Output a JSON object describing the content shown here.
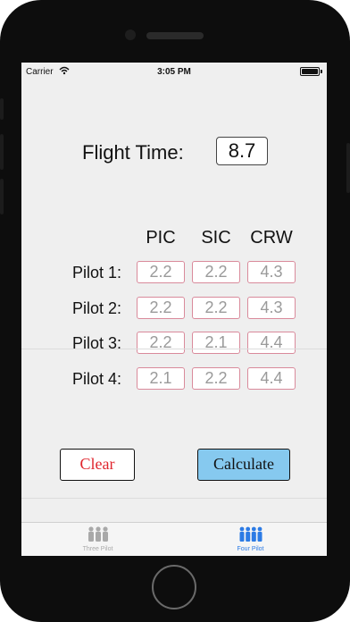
{
  "status": {
    "carrier": "Carrier",
    "time": "3:05 PM"
  },
  "flight_time": {
    "label": "Flight Time:",
    "value": "8.7"
  },
  "columns": [
    "PIC",
    "SIC",
    "CRW"
  ],
  "pilots": [
    {
      "label": "Pilot 1:",
      "values": [
        "2.2",
        "2.2",
        "4.3"
      ]
    },
    {
      "label": "Pilot 2:",
      "values": [
        "2.2",
        "2.2",
        "4.3"
      ]
    },
    {
      "label": "Pilot 3:",
      "values": [
        "2.2",
        "2.1",
        "4.4"
      ]
    },
    {
      "label": "Pilot 4:",
      "values": [
        "2.1",
        "2.2",
        "4.4"
      ]
    }
  ],
  "buttons": {
    "clear": "Clear",
    "calculate": "Calculate"
  },
  "tabs": [
    {
      "label": "Three Pilot",
      "icon": "three-pilots-icon",
      "selected": false
    },
    {
      "label": "Four Pilot",
      "icon": "four-pilots-icon",
      "selected": true
    }
  ],
  "colors": {
    "clear_text": "#e0262e",
    "calculate_bg": "#86c9ef",
    "cell_border": "#d98a9b",
    "tab_active": "#2c7be5",
    "tab_inactive": "#a9a9a9"
  }
}
